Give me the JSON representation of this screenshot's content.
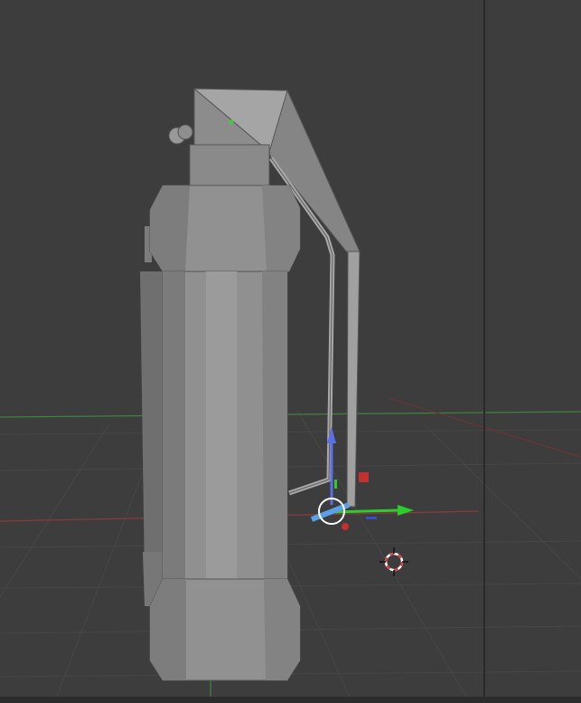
{
  "viewport": {
    "background_color": "#3d3d3d",
    "divider_color": "#2a2a2a",
    "grid_color": "#474747",
    "x_axis_color": "#8a3a3a",
    "y_axis_color": "#3f7f3f"
  },
  "scene": {
    "object": "grenade-mesh",
    "shading": "solid",
    "mesh_color": "#8e8e8e",
    "mesh_highlight_color": "#a6a6a6",
    "mesh_shadow_color": "#6a6a6a"
  },
  "gizmo": {
    "type": "move",
    "z_arrow_color": "#5a6fe6",
    "y_arrow_color": "#2ecc2e",
    "x_arrow_color": "#5aa0e6",
    "x_plane_handle_color": "#c23030",
    "origin_dot_color": "#c23030"
  },
  "cursor": {
    "icon": "3d-cursor-icon",
    "ring_colors": [
      "#d94040",
      "#ffffff"
    ]
  }
}
